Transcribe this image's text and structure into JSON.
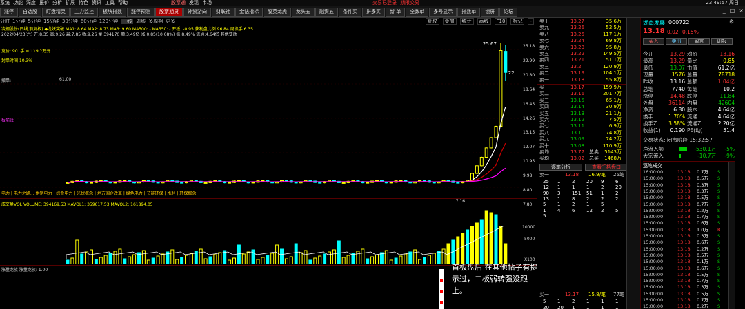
{
  "menubar": {
    "items": [
      "系统",
      "功能",
      "深度",
      "报价",
      "分析",
      "扩展",
      "特色",
      "资讯",
      "工具",
      "帮助"
    ],
    "center": [
      "股票通",
      "发现",
      "市场"
    ],
    "right": [
      "交易已登录",
      "期限交易"
    ],
    "clock": "23:49:57 周日"
  },
  "toolbar": {
    "buttons": [
      "涨停",
      "自选股",
      "盯盘精灵",
      "主力监控",
      "板块指数",
      "涨停预测",
      "股票期货",
      "外资游向",
      "财联社",
      "金钻指标",
      "股英龙虎",
      "龙头五",
      "融资五",
      "条件买",
      "拼多买",
      "新 单",
      "全数单",
      "多号显示",
      "指数单",
      "锁屏",
      "论坛"
    ],
    "active_index": 6,
    "win": [
      "_",
      "□",
      "×"
    ]
  },
  "chart": {
    "tabs": [
      "分时",
      "1分钟",
      "5分钟",
      "15分钟",
      "30分钟",
      "60分钟",
      "120分钟",
      "日线",
      "周线",
      "多周期",
      "更多"
    ],
    "active_tab": 7,
    "right_tabs": [
      "复权",
      "叠加",
      "统计",
      "画线",
      "F10",
      "标记",
      "-"
    ],
    "ma_line": "凌钢股份(日线,前复权) ◆龙妖突破 MA1: 8.64 MA2: 8.73 MA3: 9.60 MA500: - MA550: - 开板: -0.95 获利盘比例 96.84 周换手 6.35",
    "sub_line": "2022/04/23(六) 开:8.35 高:9.26 最:7.85 收:9.26 量:394170 额:3.49亿 涨:0.85(10.08%) 振:8.49% 流通:4.64亿 其他变动",
    "left_notes": [
      "竞价: 901手 = 119.7万元",
      "封单时间 10.3%",
      "撤单:",
      "61.00",
      "板前社"
    ],
    "y_ticks": [
      "25.18",
      "22.99",
      "20.80",
      "18.64",
      "16.45",
      "14.26",
      "13.15",
      "12.07",
      "10.95",
      "9.98",
      "8.80",
      "7.80"
    ],
    "peak_label": "25.67",
    "right_label": "22",
    "low_label": "7.16",
    "concepts": "电力 | 电力之路... 供销电力 | 综合电力 | 光伏概念 | 地方国企改革 | 绿色电力 | 节能环保 | 水利 | 环保概念",
    "vol_title": "成交量VOL  VOLUME: 394169.53  MAVOL1: 359617.53  MAVOL2: 161894.05",
    "vol_ticks": [
      "10000",
      "5000",
      "X100"
    ],
    "ind_title": "涨量龙族  涨量龙族: 1.00",
    "annotation": "首板盘后 在其他帖子有提示过，二板弱转强没跟上。"
  },
  "chart_data": {
    "type": "candlestick",
    "price_range": [
      7.16,
      25.67
    ],
    "highlights": {
      "peak": 25.67,
      "last_close": 22.0,
      "last_visible_low": 7.16
    }
  },
  "orderbook": {
    "sell": [
      [
        "卖十",
        13.27,
        "35.6万"
      ],
      [
        "卖九",
        13.26,
        "52.5万"
      ],
      [
        "卖八",
        13.25,
        "117.1万"
      ],
      [
        "卖七",
        13.24,
        "69.8万"
      ],
      [
        "卖六",
        13.23,
        "95.8万"
      ],
      [
        "卖五",
        13.22,
        "149.5万"
      ],
      [
        "卖四",
        13.21,
        "51.1万"
      ],
      [
        "卖三",
        13.2,
        "120.9万"
      ],
      [
        "卖二",
        13.19,
        "104.1万"
      ],
      [
        "卖一",
        13.18,
        "55.8万"
      ]
    ],
    "buy": [
      [
        "买一",
        13.17,
        "159.9万"
      ],
      [
        "买二",
        13.16,
        "201.7万"
      ],
      [
        "买三",
        13.15,
        "65.1万"
      ],
      [
        "买四",
        13.14,
        "30.9万"
      ],
      [
        "买五",
        13.13,
        "21.1万"
      ],
      [
        "买六",
        13.12,
        "7.5万"
      ],
      [
        "买七",
        13.11,
        "6.9万"
      ],
      [
        "买八",
        13.1,
        "74.8万"
      ],
      [
        "买九",
        13.09,
        "74.2万"
      ],
      [
        "买十",
        13.08,
        "110.9万"
      ]
    ],
    "sum": [
      [
        "卖均",
        "13.77",
        "总卖",
        "5143万"
      ],
      [
        "买均",
        "13.02",
        "总买",
        "1468万"
      ]
    ],
    "tabs": [
      "逐笔分析",
      "查看千档盘口"
    ],
    "summary": {
      "sell1": "卖一",
      "sell1_p": "13.18",
      "sell1_rate": "16.9/笔",
      "sell1_n": "25笔",
      "buy1": "买一",
      "buy1_p": "13.17",
      "buy1_rate": "15.8/笔",
      "buy1_n": "77笔"
    },
    "grid": [
      [
        "25",
        "1",
        "2",
        "20",
        "9",
        "6"
      ],
      [
        "12",
        "1",
        "1",
        "1",
        "2",
        "20"
      ],
      [
        "90",
        "3",
        "151",
        "51",
        "1",
        "2"
      ],
      [
        "13",
        "1",
        "8",
        "2",
        "2",
        "2"
      ],
      [
        "5",
        "1",
        "2",
        "1",
        "5",
        ""
      ],
      [
        "1",
        "4",
        "6",
        "12",
        "2",
        "5"
      ],
      [
        "5",
        "",
        "",
        "",
        "",
        ""
      ]
    ],
    "grid2": [
      [
        "5",
        "1",
        "2",
        "1",
        "1",
        "1"
      ],
      [
        "20",
        "20",
        "1",
        "1",
        "1",
        "1"
      ]
    ]
  },
  "info": {
    "name": "湖南发展",
    "code": "000722",
    "price": "13.18",
    "change": "0.02",
    "pct": "0.15%",
    "buttons": [
      "买入",
      "卖出",
      "留言",
      "研报"
    ],
    "rows": [
      [
        "今开",
        "13.29",
        "均价",
        "13.16"
      ],
      [
        "最高",
        "13.29",
        "量比",
        "0.85"
      ],
      [
        "最低",
        "13.07",
        "市值",
        "61.2亿"
      ],
      [
        "现量",
        "1576",
        "总量",
        "78718"
      ],
      [
        "昨收",
        "13.16",
        "总额",
        "1.04亿"
      ],
      [
        "总笔",
        "7740",
        "每笔",
        "10.2"
      ],
      [
        "涨停",
        "14.48",
        "跌停",
        "11.84"
      ],
      [
        "外盘",
        "36114",
        "内盘",
        "42604"
      ],
      [
        "净资",
        "6.80",
        "股本",
        "4.64亿"
      ],
      [
        "换手",
        "1.70%",
        "流通",
        "4.64亿"
      ],
      [
        "换手Z",
        "3.58%",
        "流通Z",
        "2.20亿"
      ],
      [
        "收益(1)",
        "0.190",
        "PE(动)",
        "51.4"
      ]
    ],
    "status": "交易状态: 闭市阶段 15:32:57",
    "flows": [
      [
        "净流入额",
        "-530.1万",
        "-5%"
      ],
      [
        "大宗流入",
        "-10.7万",
        "-9%"
      ]
    ],
    "ticks_title": "逐笔成交",
    "ticks": [
      [
        "16:00:00",
        "13.18",
        "0.7万",
        "S"
      ],
      [
        "15:00:00",
        "13.18",
        "0.5万",
        "S"
      ],
      [
        "15:00:00",
        "13.18",
        "0.3万",
        "S"
      ],
      [
        "15:00:00",
        "13.18",
        "0.3万",
        "S"
      ],
      [
        "15:00:00",
        "13.18",
        "0.5万",
        "S"
      ],
      [
        "15:00:00",
        "13.18",
        "0.7万",
        "S"
      ],
      [
        "15:00:00",
        "13.18",
        "0.2万",
        "S"
      ],
      [
        "15:00:00",
        "13.18",
        "0.7万",
        "S"
      ],
      [
        "15:00:00",
        "13.18",
        "0.6万",
        "S"
      ],
      [
        "15:00:00",
        "13.18",
        "1.0万",
        "B"
      ],
      [
        "15:00:00",
        "13.18",
        "0.3万",
        "S"
      ],
      [
        "15:00:00",
        "13.18",
        "0.6万",
        "S"
      ],
      [
        "15:00:00",
        "13.18",
        "0.2万",
        "S"
      ],
      [
        "15:00:00",
        "13.18",
        "0.5万",
        "S"
      ],
      [
        "15:00:00",
        "13.18",
        "0.1万",
        "S"
      ],
      [
        "15:00:00",
        "13.18",
        "0.6万",
        "S"
      ],
      [
        "15:00:00",
        "13.18",
        "0.5万",
        "S"
      ],
      [
        "15:00:00",
        "13.18",
        "0.7万",
        "S"
      ],
      [
        "15:00:00",
        "13.18",
        "0.3万",
        "S"
      ],
      [
        "15:00:00",
        "13.18",
        "0.5万",
        "S"
      ],
      [
        "15:00:00",
        "13.18",
        "0.7万",
        "S"
      ],
      [
        "15:00:00",
        "13.18",
        "0.2万",
        "S"
      ]
    ]
  }
}
